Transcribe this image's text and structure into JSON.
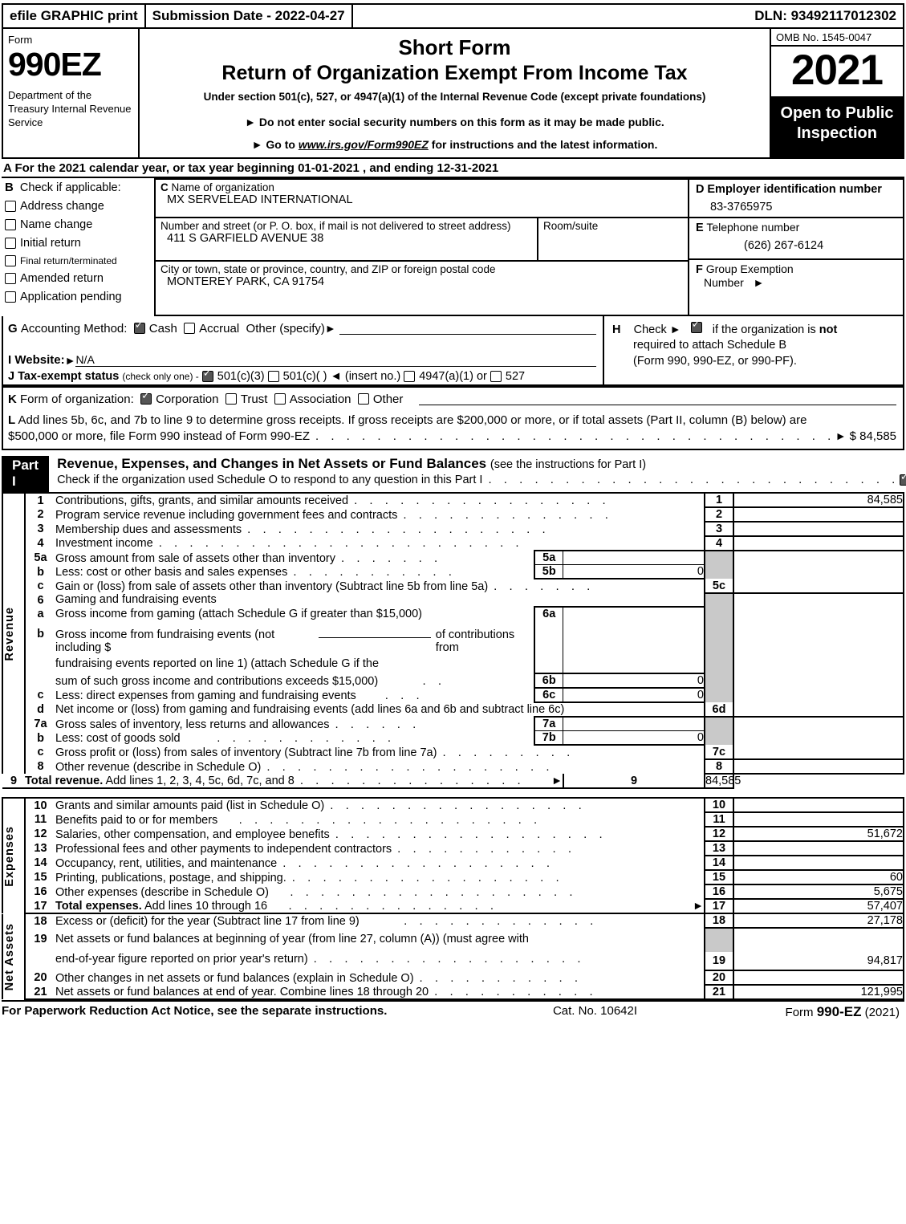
{
  "efile": {
    "print_label": "efile GRAPHIC print",
    "submission_date": "Submission Date - 2022-04-27",
    "dln": "DLN: 93492117012302"
  },
  "header": {
    "form_word": "Form",
    "form_number": "990EZ",
    "department": "Department of the Treasury Internal Revenue Service",
    "title_short": "Short Form",
    "title_main": "Return of Organization Exempt From Income Tax",
    "subtitle": "Under section 501(c), 527, or 4947(a)(1) of the Internal Revenue Code (except private foundations)",
    "bullet1": "Do not enter social security numbers on this form as it may be made public.",
    "bullet2_pre": "Go to ",
    "bullet2_url": "www.irs.gov/Form990EZ",
    "bullet2_post": " for instructions and the latest information.",
    "omb": "OMB No. 1545-0047",
    "year": "2021",
    "open_to_public": "Open to Public Inspection"
  },
  "lineA": "A  For the 2021 calendar year, or tax year beginning 01-01-2021 , and ending 12-31-2021",
  "sectionB": {
    "letter": "B",
    "title": "Check if applicable:",
    "items": [
      {
        "label": "Address change",
        "checked": false
      },
      {
        "label": "Name change",
        "checked": false
      },
      {
        "label": "Initial return",
        "checked": false
      },
      {
        "label": "Final return/terminated",
        "checked": false
      },
      {
        "label": "Amended return",
        "checked": false
      },
      {
        "label": "Application pending",
        "checked": false
      }
    ]
  },
  "sectionC": {
    "letter": "C",
    "name_label": "Name of organization",
    "name_value": "MX SERVELEAD INTERNATIONAL",
    "street_label": "Number and street (or P. O. box, if mail is not delivered to street address)",
    "street_value": "411 S GARFIELD AVENUE 38",
    "room_label": "Room/suite",
    "room_value": "",
    "city_label": "City or town, state or province, country, and ZIP or foreign postal code",
    "city_value": "MONTEREY PARK, CA   91754"
  },
  "sectionD": {
    "letter": "D",
    "label": "Employer identification number",
    "value": "83-3765975"
  },
  "sectionE": {
    "letter": "E",
    "label": "Telephone number",
    "value": "(626) 267-6124"
  },
  "sectionF": {
    "letter": "F",
    "label": "Group Exemption",
    "label2": "Number",
    "value": ""
  },
  "sectionG": {
    "letter": "G",
    "label": "Accounting Method:",
    "cash": "Cash",
    "cash_checked": true,
    "accrual": "Accrual",
    "accrual_checked": false,
    "other": "Other (specify)",
    "other_value": ""
  },
  "sectionH": {
    "letter": "H",
    "check_label": "Check",
    "checked": true,
    "text1_pre": "if the organization is ",
    "text1_bold": "not",
    "text2": "required to attach Schedule B",
    "text3": "(Form 990, 990-EZ, or 990-PF)."
  },
  "sectionI": {
    "letter": "I",
    "label": "Website:",
    "value": "N/A"
  },
  "sectionJ": {
    "letter": "J",
    "label": "Tax-exempt status",
    "note": "(check only one) -",
    "opt1": "501(c)(3)",
    "opt1_checked": true,
    "opt2": "501(c)(   )",
    "opt2_checked": false,
    "insert": "(insert no.)",
    "opt3": "4947(a)(1) or",
    "opt3_checked": false,
    "opt4": "527",
    "opt4_checked": false
  },
  "sectionK": {
    "letter": "K",
    "label": "Form of organization:",
    "options": [
      {
        "label": "Corporation",
        "checked": true
      },
      {
        "label": "Trust",
        "checked": false
      },
      {
        "label": "Association",
        "checked": false
      },
      {
        "label": "Other",
        "checked": false
      }
    ]
  },
  "sectionL": {
    "letter": "L",
    "line1": "Add lines 5b, 6c, and 7b to line 9 to determine gross receipts. If gross receipts are $200,000 or more, or if total assets (Part II, column (B) below) are",
    "line2": "$500,000 or more, file Form 990 instead of Form 990-EZ",
    "amount": "$ 84,585"
  },
  "partI": {
    "tag": "Part I",
    "title": "Revenue, Expenses, and Changes in Net Assets or Fund Balances",
    "title_note": "(see the instructions for Part I)",
    "schedule_o": "Check if the organization used Schedule O to respond to any question in this Part I",
    "schedule_o_checked": true
  },
  "vertical_labels": {
    "revenue": "Revenue",
    "expenses": "Expenses",
    "net_assets": "Net Assets"
  },
  "revenue_lines": [
    {
      "no": "1",
      "text": "Contributions, gifts, grants, and similar amounts received",
      "box": "1",
      "amount": "84,585"
    },
    {
      "no": "2",
      "text": "Program service revenue including government fees and contracts",
      "box": "2",
      "amount": ""
    },
    {
      "no": "3",
      "text": "Membership dues and assessments",
      "box": "3",
      "amount": ""
    },
    {
      "no": "4",
      "text": "Investment income",
      "box": "4",
      "amount": ""
    }
  ],
  "line5": {
    "a": {
      "no": "5a",
      "text": "Gross amount from sale of assets other than inventory",
      "box": "5a",
      "amount": ""
    },
    "b": {
      "no": "b",
      "text": "Less: cost or other basis and sales expenses",
      "box": "5b",
      "amount": "0"
    },
    "c": {
      "no": "c",
      "text": "Gain or (loss) from sale of assets other than inventory (Subtract line 5b from line 5a)",
      "box": "5c",
      "amount": ""
    }
  },
  "line6": {
    "head": {
      "no": "6",
      "text": "Gaming and fundraising events"
    },
    "a": {
      "no": "a",
      "text": "Gross income from gaming (attach Schedule G if greater than $15,000)",
      "box": "6a",
      "amount": ""
    },
    "b": {
      "no": "b",
      "text1": "Gross income from fundraising events (not including $",
      "text1b": "of contributions from",
      "text2": "fundraising events reported on line 1) (attach Schedule G if the",
      "text3": "sum of such gross income and contributions exceeds $15,000)",
      "box": "6b",
      "amount": "0"
    },
    "c": {
      "no": "c",
      "text": "Less: direct expenses from gaming and fundraising events",
      "box": "6c",
      "amount": "0"
    },
    "d": {
      "no": "d",
      "text": "Net income or (loss) from gaming and fundraising events (add lines 6a and 6b and subtract line 6c)",
      "box": "6d",
      "amount": ""
    }
  },
  "line7": {
    "a": {
      "no": "7a",
      "text": "Gross sales of inventory, less returns and allowances",
      "box": "7a",
      "amount": ""
    },
    "b": {
      "no": "b",
      "text": "Less: cost of goods sold",
      "box": "7b",
      "amount": "0"
    },
    "c": {
      "no": "c",
      "text": "Gross profit or (loss) from sales of inventory (Subtract line 7b from line 7a)",
      "box": "7c",
      "amount": ""
    }
  },
  "line8": {
    "no": "8",
    "text": "Other revenue (describe in Schedule O)",
    "box": "8",
    "amount": ""
  },
  "line9": {
    "no": "9",
    "text_bold": "Total revenue.",
    "text": " Add lines 1, 2, 3, 4, 5c, 6d, 7c, and 8",
    "box": "9",
    "amount": "84,585"
  },
  "expense_lines": [
    {
      "no": "10",
      "text": "Grants and similar amounts paid (list in Schedule O)",
      "box": "10",
      "amount": ""
    },
    {
      "no": "11",
      "text": "Benefits paid to or for members",
      "box": "11",
      "amount": ""
    },
    {
      "no": "12",
      "text": "Salaries, other compensation, and employee benefits",
      "box": "12",
      "amount": "51,672"
    },
    {
      "no": "13",
      "text": "Professional fees and other payments to independent contractors",
      "box": "13",
      "amount": ""
    },
    {
      "no": "14",
      "text": "Occupancy, rent, utilities, and maintenance",
      "box": "14",
      "amount": ""
    },
    {
      "no": "15",
      "text": "Printing, publications, postage, and shipping.",
      "box": "15",
      "amount": "60"
    },
    {
      "no": "16",
      "text": "Other expenses (describe in Schedule O)",
      "box": "16",
      "amount": "5,675"
    }
  ],
  "line17": {
    "no": "17",
    "text_bold": "Total expenses.",
    "text": " Add lines 10 through 16",
    "box": "17",
    "amount": "57,407"
  },
  "line18": {
    "no": "18",
    "text": "Excess or (deficit) for the year (Subtract line 17 from line 9)",
    "box": "18",
    "amount": "27,178"
  },
  "line19": {
    "no": "19",
    "text1": "Net assets or fund balances at beginning of year (from line 27, column (A)) (must agree with",
    "text2": "end-of-year figure reported on prior year's return)",
    "box": "19",
    "amount": "94,817"
  },
  "line20": {
    "no": "20",
    "text": "Other changes in net assets or fund balances (explain in Schedule O)",
    "box": "20",
    "amount": ""
  },
  "line21": {
    "no": "21",
    "text": "Net assets or fund balances at end of year. Combine lines 18 through 20",
    "box": "21",
    "amount": "121,995"
  },
  "footer": {
    "notice": "For Paperwork Reduction Act Notice, see the separate instructions.",
    "cat": "Cat. No. 10642I",
    "form_pre": "Form ",
    "form_bold": "990-EZ",
    "form_post": " (2021)"
  }
}
